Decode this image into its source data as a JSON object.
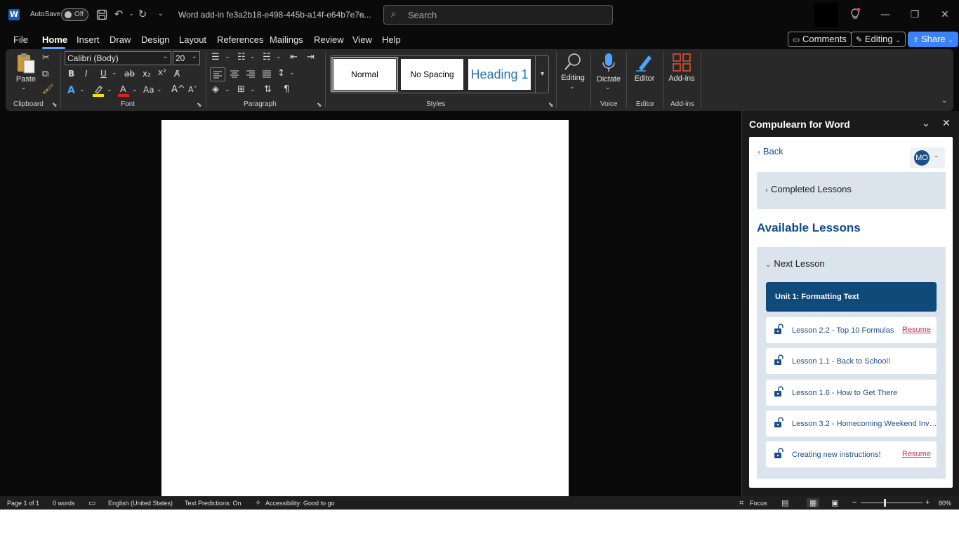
{
  "app": {
    "autosave_label": "AutoSave",
    "autosave_state": "Off",
    "doc_title": "Word add-in fe3a2b18-e498-445b-a14f-e64b7e7a...",
    "search_placeholder": "Search"
  },
  "menu": {
    "items": [
      "File",
      "Home",
      "Insert",
      "Draw",
      "Design",
      "Layout",
      "References",
      "Mailings",
      "Review",
      "View",
      "Help"
    ],
    "active": "Home",
    "comments_label": "Comments",
    "editing_label": "Editing",
    "share_label": "Share"
  },
  "ribbon": {
    "clipboard": {
      "paste_label": "Paste",
      "group_label": "Clipboard"
    },
    "font": {
      "font_name": "Calibri (Body)",
      "font_size": "20",
      "group_label": "Font"
    },
    "paragraph": {
      "group_label": "Paragraph"
    },
    "styles": {
      "items": [
        "Normal",
        "No Spacing",
        "Heading 1"
      ],
      "group_label": "Styles"
    },
    "editing": {
      "label": "Editing"
    },
    "voice": {
      "dictate_label": "Dictate",
      "group_label": "Voice"
    },
    "editor": {
      "label": "Editor",
      "group_label": "Editor"
    },
    "addins": {
      "label": "Add-ins",
      "group_label": "Add-ins"
    }
  },
  "pane": {
    "title": "Compulearn for Word",
    "back_label": "Back",
    "avatar_initials": "MO",
    "completed_label": "Completed Lessons",
    "available_title": "Available Lessons",
    "next_lesson_label": "Next Lesson",
    "unit_title": "Unit 1: Formatting Text",
    "lessons": [
      {
        "title": "Lesson 2.2 - Top 10 Formulas",
        "action": "Resume"
      },
      {
        "title": "Lesson 1.1 - Back to School!",
        "action": ""
      },
      {
        "title": "Lesson 1.6 - How to Get There",
        "action": ""
      },
      {
        "title": "Lesson 3.2 - Homecoming Weekend Invit...",
        "action": ""
      },
      {
        "title": "Creating new instructions!",
        "action": "Resume"
      }
    ]
  },
  "status": {
    "page": "Page 1 of 1",
    "words": "0 words",
    "language": "English (United States)",
    "predictions": "Text Predictions: On",
    "accessibility": "Accessibility: Good to go",
    "focus": "Focus",
    "zoom": "80%"
  },
  "colors": {
    "accent": "#3b82f6",
    "unit_header": "#0e4a7a",
    "lesson_link": "#1e4d8c",
    "resume_link": "#c8325a",
    "accordion_bg": "#dbe3ec",
    "font_color_red": "#e02020",
    "highlight_yellow": "#f5e000",
    "addins_orange": "#e2502c",
    "editor_blue": "#4aa3ff"
  },
  "icons": [
    "word-logo-icon",
    "save-icon",
    "undo-icon",
    "redo-icon",
    "search-icon",
    "lightbulb-icon",
    "minimize-icon",
    "restore-icon",
    "close-icon",
    "paste-icon",
    "cut-icon",
    "copy-icon",
    "format-painter-icon",
    "microphone-icon",
    "pen-icon",
    "addins-grid-icon",
    "lock-open-icon"
  ]
}
